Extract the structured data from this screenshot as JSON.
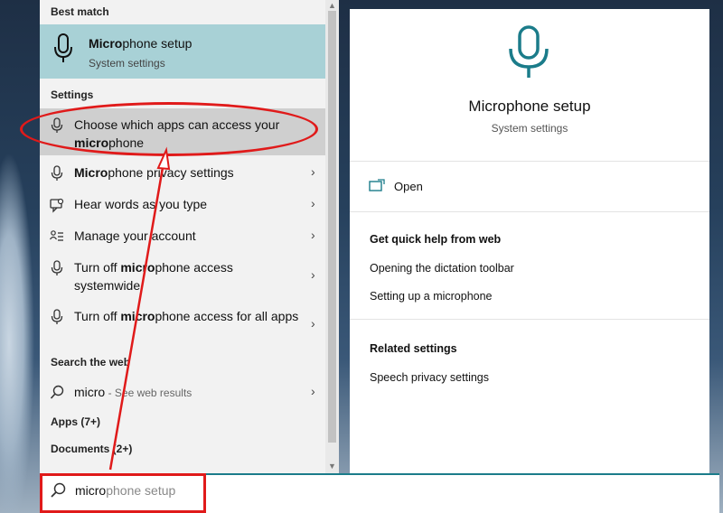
{
  "left_panel": {
    "best_match_header": "Best match",
    "best_match": {
      "title_bold": "Micro",
      "title_rest": "phone setup",
      "subtitle": "System settings",
      "icon": "microphone-icon"
    },
    "settings_header": "Settings",
    "settings_items": [
      {
        "pre": "Choose which apps can access your ",
        "bold": "micro",
        "post": "phone",
        "icon": "microphone-icon",
        "selected": true
      },
      {
        "pre": "",
        "bold": "Micro",
        "post": "phone privacy settings",
        "icon": "microphone-icon"
      },
      {
        "pre": "Hear words as you type",
        "bold": "",
        "post": "",
        "icon": "speech-icon"
      },
      {
        "pre": "Manage your account",
        "bold": "",
        "post": "",
        "icon": "account-list-icon"
      },
      {
        "pre": "Turn off ",
        "bold": "micro",
        "post": "phone access systemwide",
        "icon": "microphone-icon"
      },
      {
        "pre": "Turn off ",
        "bold": "micro",
        "post": "phone access for all apps",
        "icon": "microphone-icon"
      }
    ],
    "web_header": "Search the web",
    "web_item": {
      "query": "micro",
      "suffix": " - See web results",
      "icon": "search-icon"
    },
    "apps_header": "Apps (7+)",
    "documents_header": "Documents (2+)"
  },
  "right_panel": {
    "title": "Microphone setup",
    "subtitle": "System settings",
    "open_label": "Open",
    "quick_help_header": "Get quick help from web",
    "quick_help_links": [
      "Opening the dictation toolbar",
      "Setting up a microphone"
    ],
    "related_header": "Related settings",
    "related_links": [
      "Speech privacy settings"
    ]
  },
  "search": {
    "typed": "micro",
    "suggestion": "phone setup"
  },
  "colors": {
    "accent": "#1b7c8a",
    "best_match_bg": "#a8d1d6",
    "annotation_red": "#e01a1a"
  }
}
